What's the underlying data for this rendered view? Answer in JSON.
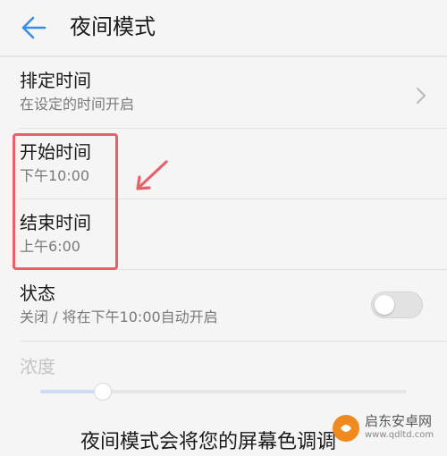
{
  "header": {
    "title": "夜间模式",
    "back_icon": "arrow-left-icon"
  },
  "schedule": {
    "title": "排定时间",
    "subtitle": "在设定的时间开启",
    "icon": "chevron-right-icon"
  },
  "start_time": {
    "title": "开始时间",
    "value": "下午10:00"
  },
  "end_time": {
    "title": "结束时间",
    "value": "上午6:00"
  },
  "status": {
    "title": "状态",
    "subtitle": "关闭 / 将在下午10:00自动开启",
    "toggle_on": false
  },
  "intensity": {
    "label": "浓度",
    "level": 0.17,
    "enabled": false
  },
  "footer": {
    "text": "夜间模式会将您的屏幕色调调"
  },
  "annotation": {
    "highlight_color": "#e8606a"
  },
  "watermark": {
    "name": "启东安卓网",
    "url": "www.qdltd.com"
  },
  "colors": {
    "accent": "#3a8ee6",
    "background": "#f5f5f5"
  }
}
